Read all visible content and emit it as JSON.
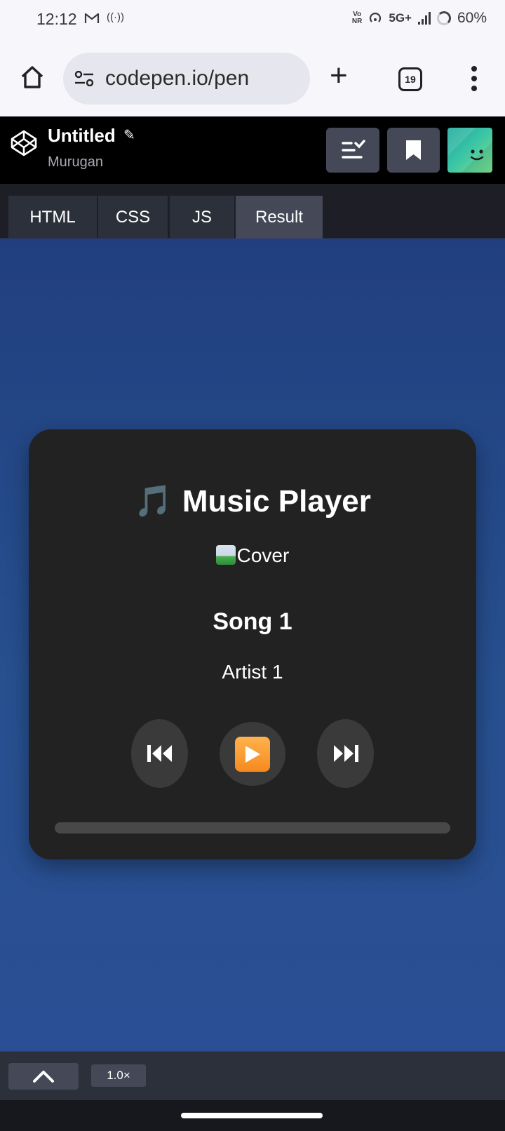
{
  "status_bar": {
    "time": "12:12",
    "vonr_top": "Vo",
    "vonr_bottom": "NR",
    "network": "5G+",
    "battery": "60%"
  },
  "browser": {
    "url": "codepen.io/pen",
    "tab_count": "19"
  },
  "codepen": {
    "title": "Untitled",
    "edit_glyph": "✎",
    "author": "Murugan",
    "tabs": [
      "HTML",
      "CSS",
      "JS",
      "Result"
    ],
    "active_tab": "Result"
  },
  "player": {
    "title_icon": "🎵",
    "title": "Music Player",
    "cover_alt": "Cover",
    "song": "Song 1",
    "artist": "Artist 1",
    "progress": 0
  },
  "bottom_bar": {
    "zoom": "1.0×"
  },
  "colors": {
    "result_bg": "#264b8f",
    "player_bg": "#222222",
    "button_bg": "#3a3a3a",
    "codepen_tab_active": "#444857"
  }
}
